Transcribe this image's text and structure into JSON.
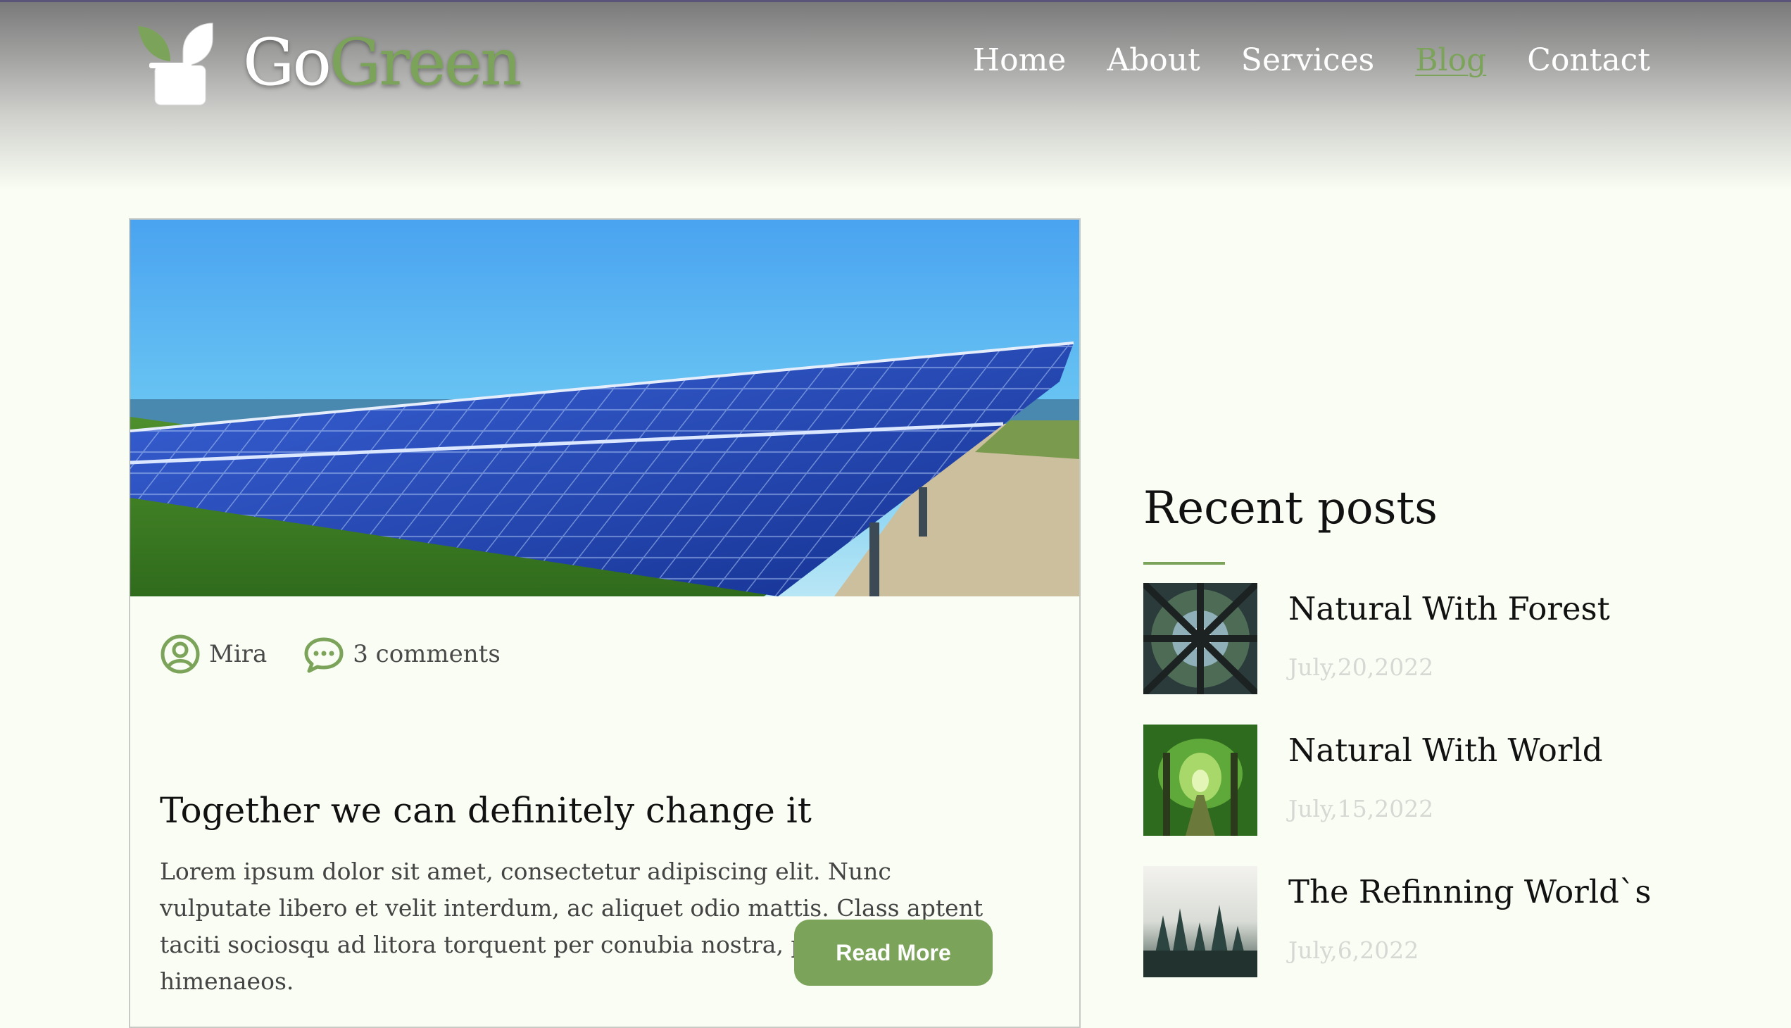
{
  "brand": {
    "name_part1": "Go",
    "name_part2": "Green",
    "accent_color": "#7ca35a"
  },
  "nav": {
    "items": [
      {
        "label": "Home",
        "active": false
      },
      {
        "label": "About",
        "active": false
      },
      {
        "label": "Services",
        "active": false
      },
      {
        "label": "Blog",
        "active": true
      },
      {
        "label": "Contact",
        "active": false
      }
    ]
  },
  "post": {
    "image_icon": "solar-panels-photo",
    "author": "Mira",
    "author_icon": "user-circle-icon",
    "comments": "3 comments",
    "comments_icon": "chat-bubble-icon",
    "title": "Together we can definitely change it",
    "excerpt": "Lorem ipsum dolor sit amet, consectetur adipiscing elit. Nunc vulputate libero et velit interdum, ac aliquet odio mattis. Class aptent taciti sociosqu ad litora torquent per conubia nostra, per inceptos himenaeos.",
    "read_more_label": "Read More"
  },
  "sidebar": {
    "title": "Recent posts",
    "recent_posts": [
      {
        "title": "Natural With Forest",
        "date": "July,20,2022",
        "thumb": "forest-canopy-photo"
      },
      {
        "title": "Natural With World",
        "date": "July,15,2022",
        "thumb": "green-tree-tunnel-photo"
      },
      {
        "title": "The Refinning World`s",
        "date": "July,6,2022",
        "thumb": "misty-pine-forest-photo"
      }
    ]
  }
}
